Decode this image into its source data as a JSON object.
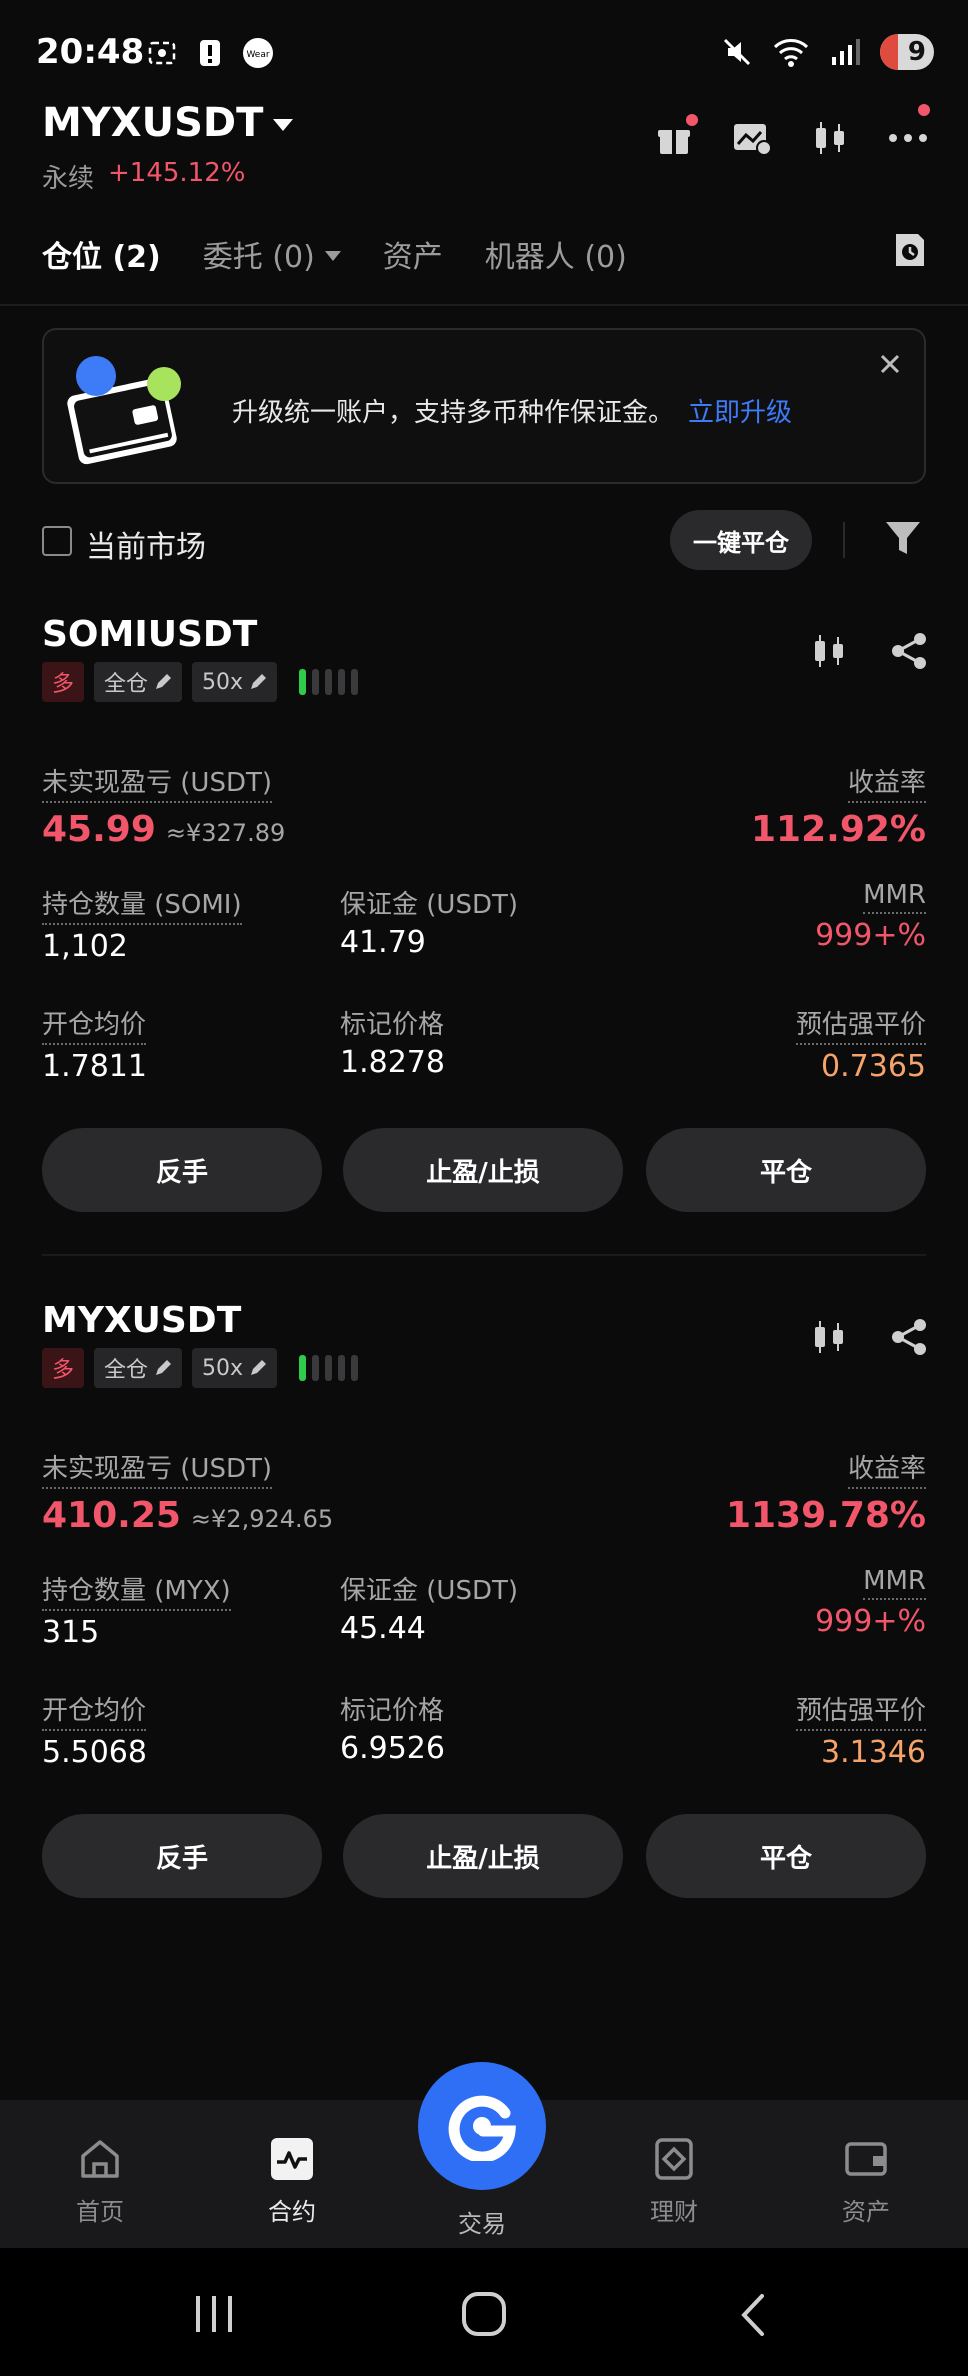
{
  "status_bar": {
    "time": "20:48",
    "battery": "9"
  },
  "header": {
    "symbol": "MYXUSDT",
    "type_label": "永续",
    "change": "+145.12%"
  },
  "tabs": {
    "positions": "仓位 (2)",
    "orders": "委托 (0)",
    "assets": "资产",
    "bots": "机器人 (0)"
  },
  "banner": {
    "text": "升级统一账户，支持多币种作保证金。",
    "link": "立即升级"
  },
  "filter": {
    "current_market": "当前市场",
    "close_all": "一键平仓"
  },
  "positions": [
    {
      "symbol": "SOMIUSDT",
      "side": "多",
      "margin_mode": "全仓",
      "leverage": "50x",
      "risk_level": 1,
      "pnl_label": "未实现盈亏 (USDT)",
      "pnl": "45.99",
      "pnl_cny": "≈¥327.89",
      "roe_label": "收益率",
      "roe": "112.92%",
      "qty_label": "持仓数量 (SOMI)",
      "qty": "1,102",
      "margin_label": "保证金 (USDT)",
      "margin": "41.79",
      "mmr_label": "MMR",
      "mmr": "999+%",
      "entry_label": "开仓均价",
      "entry": "1.7811",
      "mark_label": "标记价格",
      "mark": "1.8278",
      "liq_label": "预估强平价",
      "liq": "0.7365",
      "btn_reverse": "反手",
      "btn_tpsl": "止盈/止损",
      "btn_close": "平仓"
    },
    {
      "symbol": "MYXUSDT",
      "side": "多",
      "margin_mode": "全仓",
      "leverage": "50x",
      "risk_level": 1,
      "pnl_label": "未实现盈亏 (USDT)",
      "pnl": "410.25",
      "pnl_cny": "≈¥2,924.65",
      "roe_label": "收益率",
      "roe": "1139.78%",
      "qty_label": "持仓数量 (MYX)",
      "qty": "315",
      "margin_label": "保证金 (USDT)",
      "margin": "45.44",
      "mmr_label": "MMR",
      "mmr": "999+%",
      "entry_label": "开仓均价",
      "entry": "5.5068",
      "mark_label": "标记价格",
      "mark": "6.9526",
      "liq_label": "预估强平价",
      "liq": "3.1346",
      "btn_reverse": "反手",
      "btn_tpsl": "止盈/止损",
      "btn_close": "平仓"
    }
  ],
  "bottom_nav": {
    "home": "首页",
    "futures": "合约",
    "trade": "交易",
    "earn": "理财",
    "assets": "资产"
  },
  "colors": {
    "up_red": "#f2566a",
    "accent_blue": "#2f6ff5",
    "liq_orange": "#f5a26b",
    "risk_green": "#2ecc48"
  }
}
